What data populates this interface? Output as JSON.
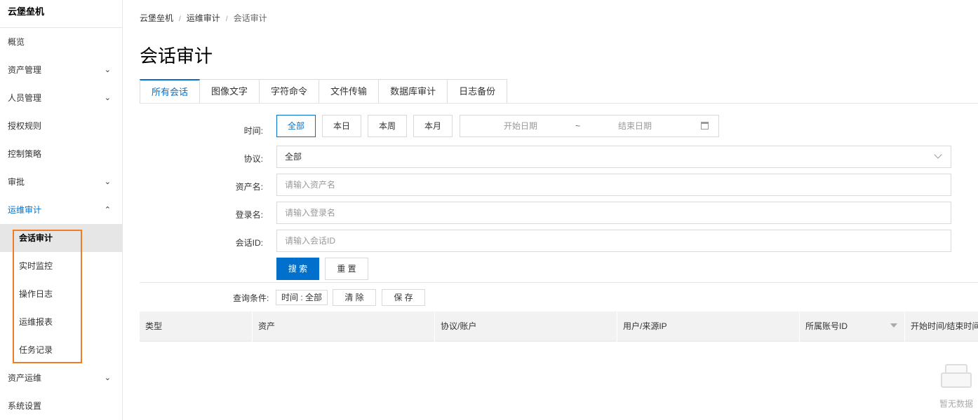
{
  "sidebar": {
    "brand": "云堡垒机",
    "items": [
      {
        "label": "概览"
      },
      {
        "label": "资产管理",
        "chevron": "⌄"
      },
      {
        "label": "人员管理",
        "chevron": "⌄"
      },
      {
        "label": "授权规则"
      },
      {
        "label": "控制策略"
      },
      {
        "label": "审批",
        "chevron": "⌄"
      },
      {
        "label": "运维审计",
        "chevron": "⌃"
      }
    ],
    "sub_items": [
      {
        "label": "会话审计"
      },
      {
        "label": "实时监控"
      },
      {
        "label": "操作日志"
      },
      {
        "label": "运维报表"
      },
      {
        "label": "任务记录"
      }
    ],
    "items_after": [
      {
        "label": "资产运维",
        "chevron": "⌄"
      },
      {
        "label": "系统设置"
      }
    ]
  },
  "breadcrumb": [
    "云堡垒机",
    "运维审计",
    "会话审计"
  ],
  "breadcrumb_sep": "/",
  "page_title": "会话审计",
  "tabs": [
    "所有会话",
    "图像文字",
    "字符命令",
    "文件传输",
    "数据库审计",
    "日志备份"
  ],
  "form": {
    "time_label": "时间:",
    "time_buttons": [
      "全部",
      "本日",
      "本周",
      "本月"
    ],
    "date_start_placeholder": "开始日期",
    "date_sep": "~",
    "date_end_placeholder": "结束日期",
    "protocol_label": "协议:",
    "protocol_value": "全部",
    "asset_label": "资产名:",
    "asset_placeholder": "请输入资产名",
    "login_label": "登录名:",
    "login_placeholder": "请输入登录名",
    "session_label": "会话ID:",
    "session_placeholder": "请输入会话ID",
    "search_button": "搜 索",
    "reset_button": "重 置"
  },
  "query": {
    "label": "查询条件:",
    "condition_tag": "时间 : 全部",
    "clear_button": "清 除",
    "save_button": "保 存"
  },
  "table": {
    "headers": [
      "类型",
      "资产",
      "协议/账户",
      "用户/来源IP",
      "所属账号ID",
      "开始时间/结束时间"
    ]
  },
  "empty_text": "暂无数据",
  "colors": {
    "accent": "#0070cc",
    "highlight_box": "#f07c26"
  }
}
